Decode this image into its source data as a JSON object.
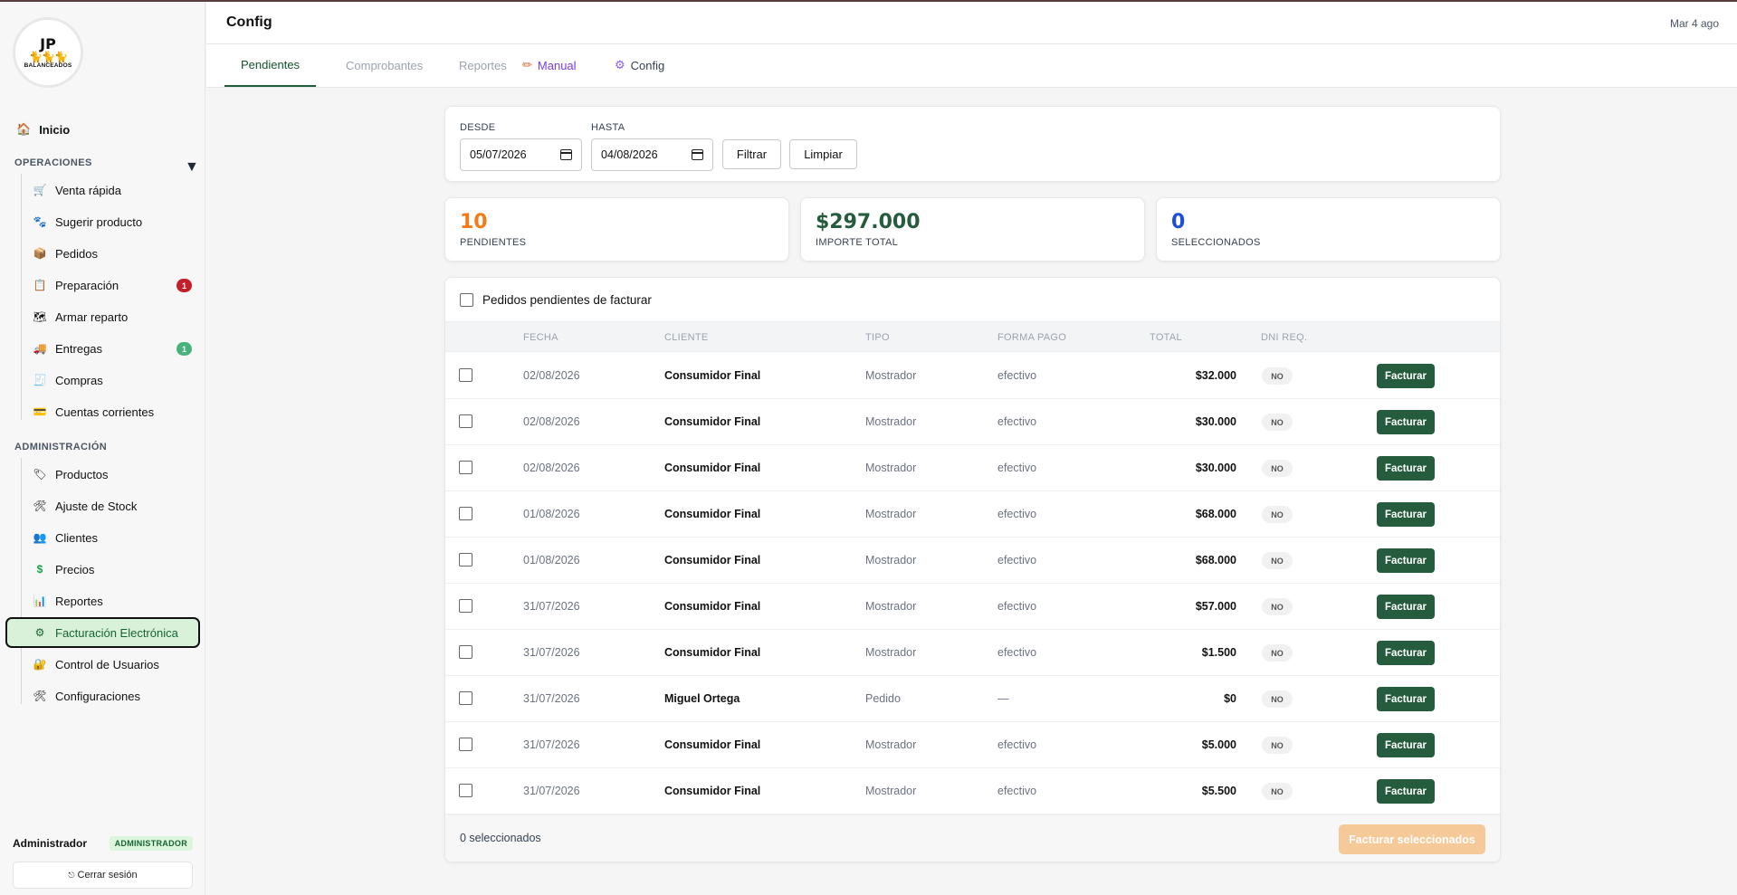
{
  "app": {
    "logo": {
      "title": "JP",
      "subtitle": "BALANCEADOS",
      "icon": "cats-logo-icon"
    },
    "page_title": "Config",
    "header_date": "Mar 4 ago"
  },
  "sidebar": {
    "home": {
      "label": "Inicio",
      "icon": "🏠"
    },
    "sections": [
      {
        "title": "OPERACIONES",
        "collapse_icon": "▼",
        "items": [
          {
            "label": "Venta rápida",
            "icon": "🛒"
          },
          {
            "label": "Sugerir producto",
            "icon": "🐾"
          },
          {
            "label": "Pedidos",
            "icon": "📦"
          },
          {
            "label": "Preparación",
            "icon": "📋",
            "badge": "1",
            "badge_color": "#c41e2a"
          },
          {
            "label": "Armar reparto",
            "icon": "🗺"
          },
          {
            "label": "Entregas",
            "icon": "🚚",
            "badge": "1",
            "badge_color": "#47b37a"
          },
          {
            "label": "Compras",
            "icon": "🧾"
          },
          {
            "label": "Cuentas corrientes",
            "icon": "💳"
          }
        ]
      },
      {
        "title": "ADMINISTRACIÓN",
        "items": [
          {
            "label": "Productos",
            "icon": "🏷"
          },
          {
            "label": "Ajuste de Stock",
            "icon": "🛠"
          },
          {
            "label": "Clientes",
            "icon": "👥"
          },
          {
            "label": "Precios",
            "icon": "$"
          },
          {
            "label": "Reportes",
            "icon": "📊"
          },
          {
            "label": "Facturación Electrónica",
            "icon": "⚙",
            "active": true
          },
          {
            "label": "Control de Usuarios",
            "icon": "🔐"
          },
          {
            "label": "Configuraciones",
            "icon": "🛠"
          }
        ]
      }
    ],
    "user": {
      "name": "Administrador",
      "role": "ADMINISTRADOR",
      "logout_label": "Cerrar sesión",
      "logout_icon": "⎋"
    }
  },
  "tabs": [
    {
      "label": "Pendientes",
      "active": true
    },
    {
      "label": "Comprobantes"
    },
    {
      "label": "Reportes"
    },
    {
      "label": "Manual",
      "icon": "✏"
    },
    {
      "label": "Config",
      "icon": "⚙"
    }
  ],
  "filters": {
    "desde_label": "DESDE",
    "desde_value": "05/07/2026",
    "hasta_label": "HASTA",
    "hasta_value": "04/08/2026",
    "filter_button": "Filtrar",
    "clear_button": "Limpiar"
  },
  "stats": [
    {
      "value": "10",
      "label": "PENDIENTES",
      "color": "#f47b16"
    },
    {
      "value": "$297.000",
      "label": "IMPORTE TOTAL",
      "color": "#245c3d"
    },
    {
      "value": "0",
      "label": "SELECCIONADOS",
      "color": "#1d4ed8"
    }
  ],
  "table": {
    "title": "Pedidos pendientes de facturar",
    "columns": [
      "FECHA",
      "CLIENTE",
      "TIPO",
      "FORMA PAGO",
      "TOTAL",
      "DNI REQ."
    ],
    "action_label": "Facturar",
    "rows": [
      {
        "fecha": "02/08/2026",
        "cliente": "Consumidor Final",
        "tipo": "Mostrador",
        "forma_pago": "efectivo",
        "total": "$32.000",
        "dni": "NO"
      },
      {
        "fecha": "02/08/2026",
        "cliente": "Consumidor Final",
        "tipo": "Mostrador",
        "forma_pago": "efectivo",
        "total": "$30.000",
        "dni": "NO"
      },
      {
        "fecha": "02/08/2026",
        "cliente": "Consumidor Final",
        "tipo": "Mostrador",
        "forma_pago": "efectivo",
        "total": "$30.000",
        "dni": "NO"
      },
      {
        "fecha": "01/08/2026",
        "cliente": "Consumidor Final",
        "tipo": "Mostrador",
        "forma_pago": "efectivo",
        "total": "$68.000",
        "dni": "NO"
      },
      {
        "fecha": "01/08/2026",
        "cliente": "Consumidor Final",
        "tipo": "Mostrador",
        "forma_pago": "efectivo",
        "total": "$68.000",
        "dni": "NO"
      },
      {
        "fecha": "31/07/2026",
        "cliente": "Consumidor Final",
        "tipo": "Mostrador",
        "forma_pago": "efectivo",
        "total": "$57.000",
        "dni": "NO"
      },
      {
        "fecha": "31/07/2026",
        "cliente": "Consumidor Final",
        "tipo": "Mostrador",
        "forma_pago": "efectivo",
        "total": "$1.500",
        "dni": "NO"
      },
      {
        "fecha": "31/07/2026",
        "cliente": "Miguel Ortega",
        "tipo": "Pedido",
        "forma_pago": "—",
        "total": "$0",
        "dni": "NO"
      },
      {
        "fecha": "31/07/2026",
        "cliente": "Consumidor Final",
        "tipo": "Mostrador",
        "forma_pago": "efectivo",
        "total": "$5.000",
        "dni": "NO"
      },
      {
        "fecha": "31/07/2026",
        "cliente": "Consumidor Final",
        "tipo": "Mostrador",
        "forma_pago": "efectivo",
        "total": "$5.500",
        "dni": "NO"
      }
    ],
    "footer_count": "0 seleccionados",
    "bulk_button": "Facturar seleccionados"
  }
}
